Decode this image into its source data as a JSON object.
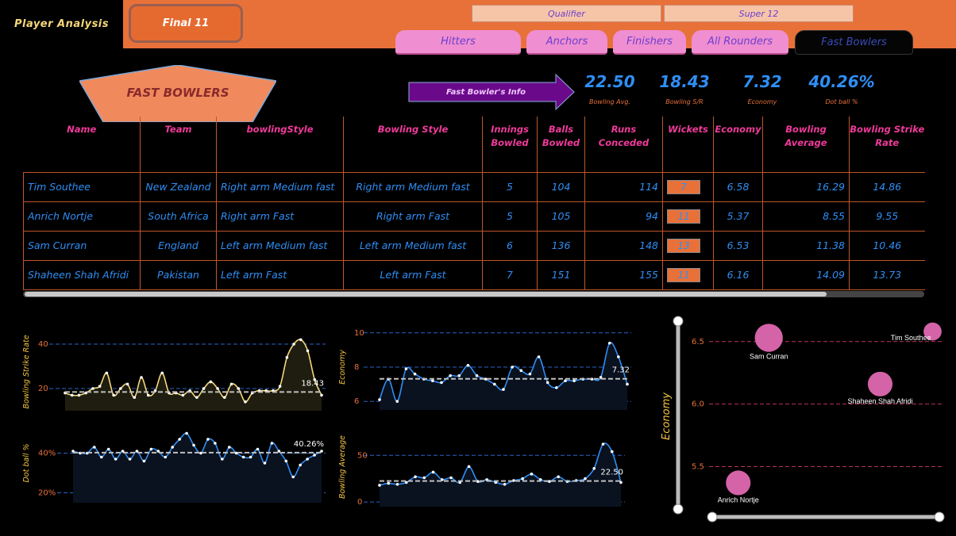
{
  "header": {
    "app_title": "Player Analysis",
    "final_button": "Final 11",
    "slicers": [
      "Qualifier",
      "Super 12"
    ],
    "tabs": [
      {
        "label": "Hitters",
        "active": false
      },
      {
        "label": "Anchors",
        "active": false
      },
      {
        "label": "Finishers",
        "active": false
      },
      {
        "label": "All Rounders",
        "active": false
      },
      {
        "label": "Fast Bowlers",
        "active": true
      }
    ]
  },
  "section_title": "FAST BOWLERS",
  "info_arrow": "Fast Bowler's Info",
  "kpis": [
    {
      "value": "22.50",
      "label": "Bowling Avg."
    },
    {
      "value": "18.43",
      "label": "Bowling S/R"
    },
    {
      "value": "7.32",
      "label": "Economy"
    },
    {
      "value": "40.26%",
      "label": "Dot ball %"
    }
  ],
  "table": {
    "headers": [
      "Name",
      "Team",
      "bowlingStyle",
      "Bowling Style",
      "Innings Bowled",
      "Balls Bowled",
      "Runs Conceded",
      "Wickets",
      "Economy",
      "Bowling Average",
      "Bowling Strike Rate"
    ],
    "rows": [
      [
        "Tim Southee",
        "New Zealand",
        "Right arm Medium fast",
        "Right arm Medium fast",
        "5",
        "104",
        "114",
        "7",
        "6.58",
        "16.29",
        "14.86"
      ],
      [
        "Anrich Nortje",
        "South Africa",
        "Right arm Fast",
        "Right arm Fast",
        "5",
        "105",
        "94",
        "11",
        "5.37",
        "8.55",
        "9.55"
      ],
      [
        "Sam Curran",
        "England",
        "Left arm Medium fast",
        "Left arm Medium fast",
        "6",
        "136",
        "148",
        "13",
        "6.53",
        "11.38",
        "10.46"
      ],
      [
        "Shaheen Shah Afridi",
        "Pakistan",
        "Left arm Fast",
        "Left arm Fast",
        "7",
        "151",
        "155",
        "11",
        "6.16",
        "14.09",
        "13.73"
      ]
    ]
  },
  "colors": {
    "accent": "#e8713a",
    "blue": "#2f8ef5",
    "pink": "#f03a9a",
    "yellow": "#f5d77a"
  },
  "chart_data": [
    {
      "type": "area",
      "ylabel": "Bowling Strike Rate",
      "ylim": [
        10,
        45
      ],
      "yticks": [
        20,
        40
      ],
      "average": 18.43,
      "average_label": "18.43",
      "values": [
        18,
        17,
        17,
        18,
        20,
        21,
        27,
        17,
        20,
        22,
        16,
        25,
        17,
        19,
        27,
        18,
        18,
        17,
        19,
        16,
        20,
        23,
        20,
        16,
        22,
        20,
        14,
        18,
        19,
        19,
        19,
        21,
        34,
        40,
        42,
        37,
        24,
        17
      ]
    },
    {
      "type": "area",
      "ylabel": "Dot ball %",
      "ylim": [
        15,
        55
      ],
      "yticks": [
        "20%",
        "40%"
      ],
      "ytick_values": [
        20,
        40
      ],
      "average": 40.26,
      "average_label": "40.26%",
      "values": [
        41,
        40,
        40,
        43,
        38,
        42,
        37,
        41,
        37,
        41,
        36,
        42,
        41,
        38,
        43,
        47,
        50,
        44,
        40,
        47,
        45,
        37,
        43,
        40,
        38,
        38,
        42,
        35,
        45,
        41,
        36,
        28,
        34,
        37,
        39,
        41
      ]
    },
    {
      "type": "area",
      "ylabel": "Economy",
      "ylim": [
        5.5,
        10.5
      ],
      "yticks": [
        6,
        8,
        10
      ],
      "average": 7.32,
      "average_label": "7.32",
      "values": [
        6.1,
        7.3,
        6.0,
        7.9,
        7.6,
        7.3,
        7.2,
        7.1,
        7.5,
        7.5,
        8.1,
        7.5,
        7.3,
        7.0,
        6.7,
        8.0,
        7.8,
        7.6,
        8.6,
        7.1,
        6.8,
        7.2,
        7.2,
        7.3,
        7.3,
        7.4,
        9.4,
        8.6,
        7.0
      ]
    },
    {
      "type": "area",
      "ylabel": "Bowling Average",
      "ylim": [
        -5,
        80
      ],
      "yticks": [
        0,
        50
      ],
      "average": 22.5,
      "average_label": "22.50",
      "values": [
        18,
        20,
        19,
        21,
        27,
        26,
        32,
        24,
        26,
        21,
        38,
        22,
        24,
        21,
        19,
        23,
        25,
        30,
        24,
        22,
        27,
        22,
        23,
        25,
        36,
        62,
        54,
        21
      ]
    },
    {
      "type": "scatter",
      "ylabel": "Economy",
      "ylim": [
        5.3,
        6.6
      ],
      "yticks": [
        5.5,
        6.0,
        6.5
      ],
      "xlim": [
        0,
        1
      ],
      "points": [
        {
          "name": "Sam Curran",
          "x": 0.23,
          "y": 6.53,
          "size": 13
        },
        {
          "name": "Tim Southee",
          "x": 0.98,
          "y": 6.58,
          "size": 7
        },
        {
          "name": "Shaheen Shah Afridi",
          "x": 0.74,
          "y": 6.16,
          "size": 11
        },
        {
          "name": "Anrich Nortje",
          "x": 0.09,
          "y": 5.37,
          "size": 11
        }
      ]
    }
  ]
}
